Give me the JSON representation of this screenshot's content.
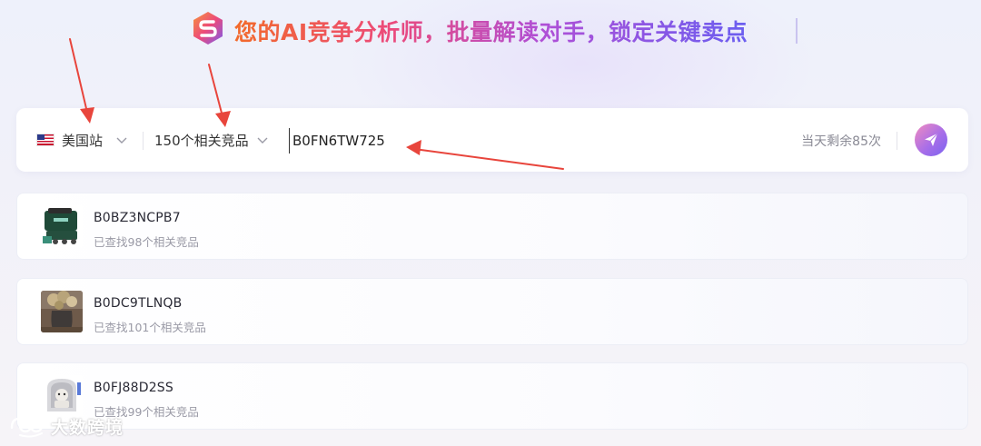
{
  "header": {
    "headline": "您的AI竞争分析师，批量解读对手，锁定关键卖点",
    "logo_icon": "s-logo-icon"
  },
  "search": {
    "site_label": "美国站",
    "site_flag_icon": "us-flag-icon",
    "competitor_count_label": "150个相关竞品",
    "asin_value": "B0FN6TW725",
    "remaining_text": "当天剩余85次",
    "send_icon": "paper-plane-icon"
  },
  "results": [
    {
      "asin": "B0BZ3NCPB7",
      "found_text": "已查找98个相关竞品",
      "thumb_icon": "green-grill-product-thumb"
    },
    {
      "asin": "B0DC9TLNQB",
      "found_text": "已查找101个相关竞品",
      "thumb_icon": "dried-flower-vase-product-thumb"
    },
    {
      "asin": "B0FJ88D2SS",
      "found_text": "已查找99个相关竞品",
      "thumb_icon": "cat-litter-box-product-thumb"
    }
  ],
  "watermark": {
    "text": "大数跨境"
  },
  "colors": {
    "accent_purple": "#7a63f0",
    "accent_pink": "#f28cc0",
    "headline_orange": "#f26a2a",
    "annotation_red": "#e8453c"
  }
}
